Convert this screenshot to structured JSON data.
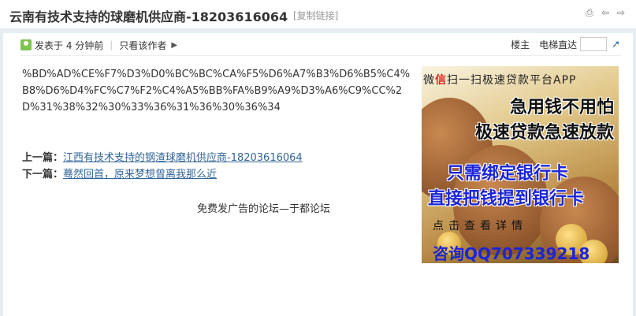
{
  "thread": {
    "title": "云南有技术支持的球磨机供应商-18203616064",
    "copy_link": "[复制链接]"
  },
  "meta": {
    "posted": "发表于 4 分钟前",
    "only_author": "只看该作者"
  },
  "floor": {
    "owner": "楼主",
    "jump_label": "电梯直达"
  },
  "post": {
    "body": "%BD%AD%CE%F7%D3%D0%BC%BC%CA%F5%D6%A7%B3%D6%B5%C4%B8%D6%D4%FC%C7%F2%C4%A5%BB%FA%B9%A9%D3%A6%C9%CC%2D%31%38%32%30%33%36%31%36%30%36%34"
  },
  "nav": {
    "prev_label": "上一篇：",
    "prev_link": "江西有技术支持的钢渣球磨机供应商-18203616064",
    "next_label": "下一篇：",
    "next_link": "蓦然回首，原来梦想曾离我那么近"
  },
  "footer": {
    "text": "免费发广告的论坛—于都论坛"
  },
  "ad": {
    "line1_a": "微",
    "line1_b": "信",
    "line1_c": "扫一扫极速贷款平台APP",
    "line2": "急用钱不用怕",
    "line3": "极速贷款急速放款",
    "line4": "只需绑定银行卡",
    "line5": "直接把钱提到银行卡",
    "line6": "点击查看详情",
    "line7": "咨询QQ707339218"
  }
}
